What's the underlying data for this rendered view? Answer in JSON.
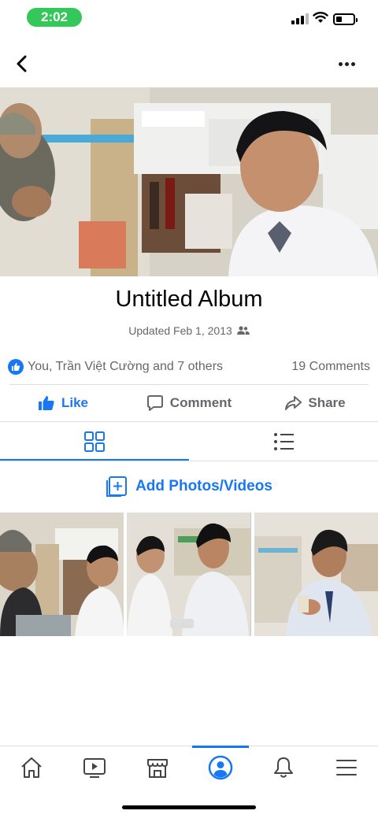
{
  "status": {
    "time": "2:02"
  },
  "album": {
    "title": "Untitled Album",
    "updated": "Updated Feb 1, 2013",
    "privacy_icon": "friends-icon"
  },
  "reactions": {
    "names": "You, Trần Việt Cường and 7 others",
    "comments": "19 Comments"
  },
  "actions": {
    "like": "Like",
    "comment": "Comment",
    "share": "Share"
  },
  "views": {
    "active": "grid",
    "items": [
      "grid-view-icon",
      "list-view-icon"
    ]
  },
  "add_photos": "Add Photos/Videos",
  "bottom_tabs": [
    {
      "icon": "home-icon"
    },
    {
      "icon": "watch-icon"
    },
    {
      "icon": "marketplace-icon"
    },
    {
      "icon": "profile-icon",
      "active": true
    },
    {
      "icon": "notifications-icon"
    },
    {
      "icon": "menu-icon"
    }
  ],
  "colors": {
    "accent": "#1877f2",
    "time_pill": "#34c759",
    "muted": "#65676b"
  }
}
